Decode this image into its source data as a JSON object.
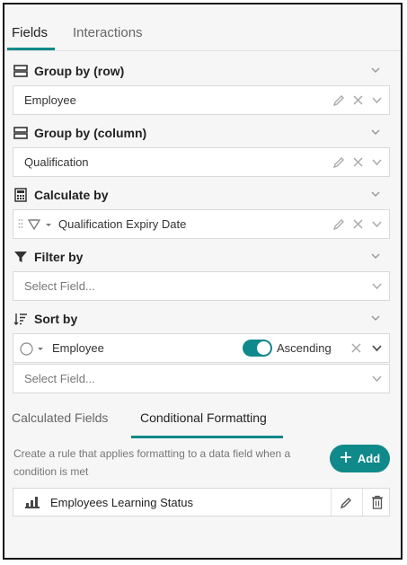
{
  "tabs": [
    {
      "label": "Fields",
      "active": true
    },
    {
      "label": "Interactions",
      "active": false
    }
  ],
  "sections": {
    "group_row": {
      "title": "Group by (row)",
      "value": "Employee"
    },
    "group_col": {
      "title": "Group by (column)",
      "value": "Qualification"
    },
    "calculate": {
      "title": "Calculate by",
      "value": "Qualification Expiry Date"
    },
    "filter": {
      "title": "Filter by",
      "placeholder": "Select Field..."
    },
    "sort": {
      "title": "Sort by",
      "value": "Employee",
      "order_label": "Ascending",
      "toggle_on": true,
      "placeholder": "Select Field..."
    }
  },
  "sub_tabs": [
    {
      "label": "Calculated Fields",
      "active": false
    },
    {
      "label": "Conditional Formatting",
      "active": true
    }
  ],
  "conditional_formatting": {
    "description": "Create a rule that applies formatting to a data field when a condition is met",
    "add_label": "Add",
    "rules": [
      {
        "label": "Employees Learning Status",
        "icon": "bar-chart-icon"
      }
    ]
  },
  "colors": {
    "accent": "#10898a",
    "background": "#f6f6f6",
    "border": "#d9d9d9"
  }
}
